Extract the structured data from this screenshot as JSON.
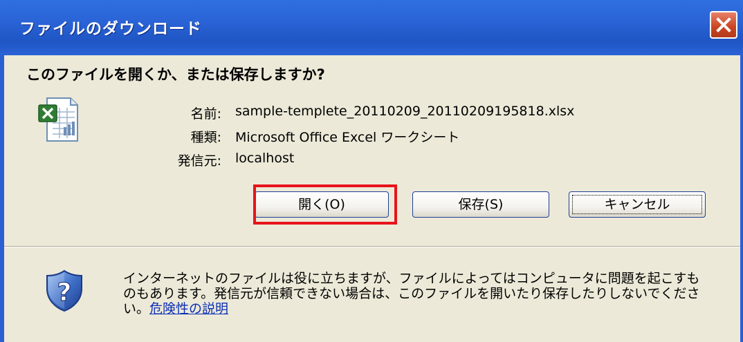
{
  "window": {
    "title": "ファイルのダウンロード",
    "close_icon": "close-icon"
  },
  "dialog": {
    "question": "このファイルを開くか、または保存しますか?",
    "file_icon": "excel-file-icon",
    "fields": [
      {
        "label": "名前:",
        "value": "sample-templete_20110209_20110209195818.xlsx"
      },
      {
        "label": "種類:",
        "value": "Microsoft Office Excel ワークシート"
      },
      {
        "label": "発信元:",
        "value": "localhost"
      }
    ],
    "buttons": {
      "open": "開く(O)",
      "save": "保存(S)",
      "cancel": "キャンセル"
    },
    "highlight_color": "#e8131b"
  },
  "warning": {
    "icon": "shield-question-icon",
    "text": "インターネットのファイルは役に立ちますが、ファイルによってはコンピュータに問題を起こすものもあります。発信元が信頼できない場合は、このファイルを開いたり保存したりしないでください。",
    "link": "危険性の説明"
  }
}
